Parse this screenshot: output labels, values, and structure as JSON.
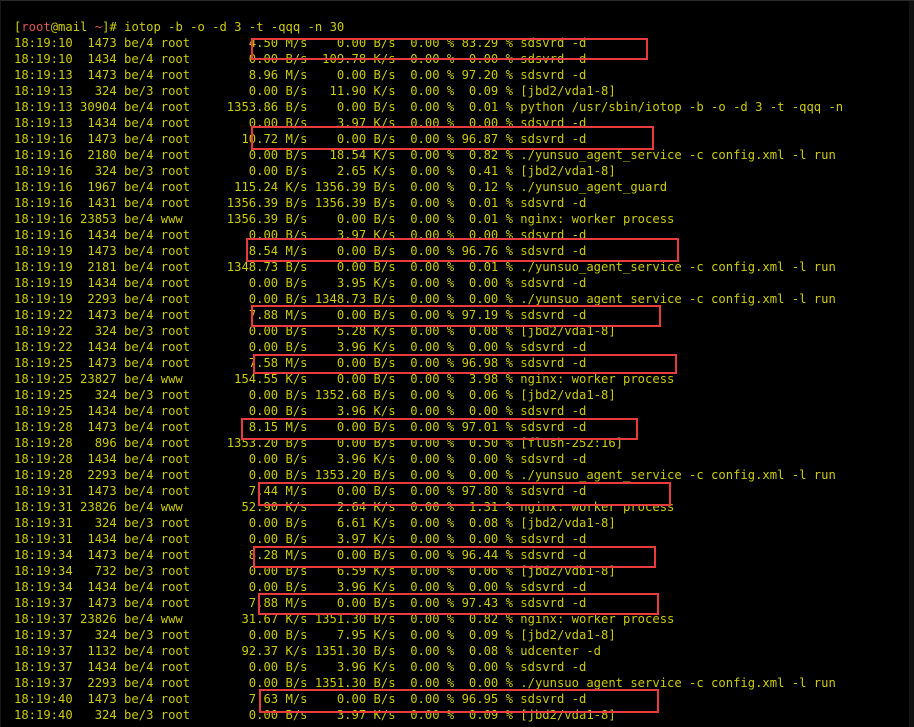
{
  "prompt": {
    "user": "root",
    "host": "mail",
    "path": "~",
    "symbol": "#",
    "command": "iotop -b -o -d 3 -t -qqq -n 30"
  },
  "rows": [
    "18:19:10  1473 be/4 root        4.50 M/s    0.00 B/s  0.00 % 83.29 % sdsvrd -d",
    "18:19:10  1434 be/4 root        0.00 B/s  109.78 K/s  0.00 %  0.00 % sdsvrd -d",
    "18:19:13  1473 be/4 root        8.96 M/s    0.00 B/s  0.00 % 97.20 % sdsvrd -d",
    "18:19:13   324 be/3 root        0.00 B/s   11.90 K/s  0.00 %  0.09 % [jbd2/vda1-8]",
    "18:19:13 30904 be/4 root     1353.86 B/s    0.00 B/s  0.00 %  0.01 % python /usr/sbin/iotop -b -o -d 3 -t -qqq -n",
    "18:19:13  1434 be/4 root        0.00 B/s    3.97 K/s  0.00 %  0.00 % sdsvrd -d",
    "18:19:16  1473 be/4 root       10.72 M/s    0.00 B/s  0.00 % 96.87 % sdsvrd -d",
    "18:19:16  2180 be/4 root        0.00 B/s   18.54 K/s  0.00 %  0.82 % ./yunsuo_agent_service -c config.xml -l run",
    "18:19:16   324 be/3 root        0.00 B/s    2.65 K/s  0.00 %  0.41 % [jbd2/vda1-8]",
    "18:19:16  1967 be/4 root      115.24 K/s 1356.39 B/s  0.00 %  0.12 % ./yunsuo_agent_guard",
    "18:19:16  1431 be/4 root     1356.39 B/s 1356.39 B/s  0.00 %  0.01 % sdsvrd -d",
    "18:19:16 23853 be/4 www      1356.39 B/s    0.00 B/s  0.00 %  0.01 % nginx: worker process",
    "18:19:16  1434 be/4 root        0.00 B/s    3.97 K/s  0.00 %  0.00 % sdsvrd -d",
    "18:19:19  1473 be/4 root        8.54 M/s    0.00 B/s  0.00 % 96.76 % sdsvrd -d",
    "18:19:19  2181 be/4 root     1348.73 B/s    0.00 B/s  0.00 %  0.01 % ./yunsuo_agent_service -c config.xml -l run",
    "18:19:19  1434 be/4 root        0.00 B/s    3.95 K/s  0.00 %  0.00 % sdsvrd -d",
    "18:19:19  2293 be/4 root        0.00 B/s 1348.73 B/s  0.00 %  0.00 % ./yunsuo_agent_service -c config.xml -l run",
    "18:19:22  1473 be/4 root        7.88 M/s    0.00 B/s  0.00 % 97.19 % sdsvrd -d",
    "18:19:22   324 be/3 root        0.00 B/s    5.28 K/s  0.00 %  0.08 % [jbd2/vda1-8]",
    "18:19:22  1434 be/4 root        0.00 B/s    3.96 K/s  0.00 %  0.00 % sdsvrd -d",
    "18:19:25  1473 be/4 root        7.58 M/s    0.00 B/s  0.00 % 96.98 % sdsvrd -d",
    "18:19:25 23827 be/4 www       154.55 K/s    0.00 B/s  0.00 %  3.98 % nginx: worker process",
    "18:19:25   324 be/3 root        0.00 B/s 1352.68 B/s  0.00 %  0.06 % [jbd2/vda1-8]",
    "18:19:25  1434 be/4 root        0.00 B/s    3.96 K/s  0.00 %  0.00 % sdsvrd -d",
    "18:19:28  1473 be/4 root        8.15 M/s    0.00 B/s  0.00 % 97.01 % sdsvrd -d",
    "18:19:28   896 be/4 root     1353.20 B/s    0.00 B/s  0.00 %  0.50 % [flush-252:16]",
    "18:19:28  1434 be/4 root        0.00 B/s    3.96 K/s  0.00 %  0.00 % sdsvrd -d",
    "18:19:28  2293 be/4 root        0.00 B/s 1353.20 B/s  0.00 %  0.00 % ./yunsuo_agent_service -c config.xml -l run",
    "18:19:31  1473 be/4 root        7.44 M/s    0.00 B/s  0.00 % 97.80 % sdsvrd -d",
    "18:19:31 23826 be/4 www        52.90 K/s    2.64 K/s  0.00 %  1.31 % nginx: worker process",
    "18:19:31   324 be/3 root        0.00 B/s    6.61 K/s  0.00 %  0.08 % [jbd2/vda1-8]",
    "18:19:31  1434 be/4 root        0.00 B/s    3.97 K/s  0.00 %  0.00 % sdsvrd -d",
    "18:19:34  1473 be/4 root        8.28 M/s    0.00 B/s  0.00 % 96.44 % sdsvrd -d",
    "18:19:34   732 be/3 root        0.00 B/s    6.59 K/s  0.00 %  0.06 % [jbd2/vdb1-8]",
    "18:19:34  1434 be/4 root        0.00 B/s    3.96 K/s  0.00 %  0.00 % sdsvrd -d",
    "18:19:37  1473 be/4 root        7.88 M/s    0.00 B/s  0.00 % 97.43 % sdsvrd -d",
    "18:19:37 23826 be/4 www        31.67 K/s 1351.30 B/s  0.00 %  0.82 % nginx: worker process",
    "18:19:37   324 be/3 root        0.00 B/s    7.95 K/s  0.00 %  0.09 % [jbd2/vda1-8]",
    "18:19:37  1132 be/4 root       92.37 K/s 1351.30 B/s  0.00 %  0.08 % udcenter -d",
    "18:19:37  1434 be/4 root        0.00 B/s    3.96 K/s  0.00 %  0.00 % sdsvrd -d",
    "18:19:37  2293 be/4 root        0.00 B/s 1351.30 B/s  0.00 %  0.00 % ./yunsuo_agent_service -c config.xml -l run",
    "18:19:40  1473 be/4 root        7.63 M/s    0.00 B/s  0.00 % 96.95 % sdsvrd -d",
    "18:19:40   324 be/3 root        0.00 B/s    3.97 K/s  0.00 %  0.09 % [jbd2/vda1-8]"
  ],
  "colors": {
    "background": "#000000",
    "text": "#cbcb00",
    "prompt_accent": "#e05555",
    "highlight_box": "#e83b3b"
  }
}
